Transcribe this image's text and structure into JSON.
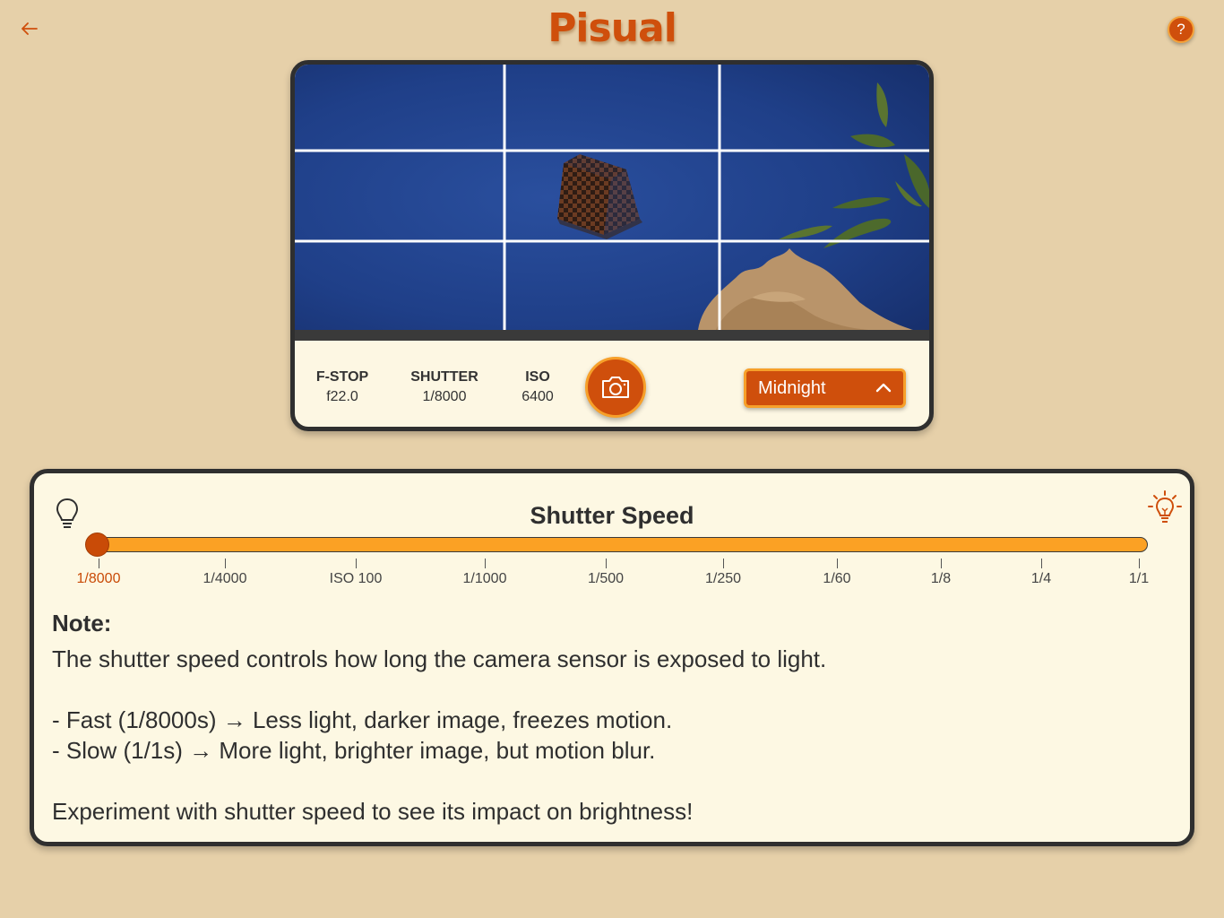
{
  "header": {
    "title": "Pisual",
    "back_icon": "back-arrow-icon",
    "help_label": "?"
  },
  "colors": {
    "background": "#e6d0a9",
    "accent": "#cf4f0c",
    "accent_light": "#fba124",
    "panel": "#fdf8e3",
    "border": "#2f2f2f"
  },
  "camera": {
    "settings": [
      {
        "label": "F-STOP",
        "value": "f22.0"
      },
      {
        "label": "SHUTTER",
        "value": "1/8000"
      },
      {
        "label": "ISO",
        "value": "6400"
      }
    ],
    "shutter_icon": "camera-icon",
    "preset": {
      "selected": "Midnight",
      "icon": "chevron-up-icon"
    },
    "viewport": {
      "grid": "rule-of-thirds",
      "subject": "checkered-cube",
      "background": "earth-satellite-view"
    }
  },
  "control": {
    "title": "Shutter Speed",
    "min_icon": "lightbulb-off-icon",
    "max_icon": "lightbulb-on-icon",
    "slider_value_fraction": 0,
    "ticks": [
      "1/8000",
      "1/4000",
      "ISO 100",
      "1/1000",
      "1/500",
      "1/250",
      "1/60",
      "1/8",
      "1/4",
      "1/1"
    ],
    "active_tick": "1/8000"
  },
  "note": {
    "title": "Note:",
    "lines": [
      "The shutter speed controls how long the camera sensor is exposed to light.",
      "",
      "- Fast (1/8000s) → Less light, darker image, freezes motion.",
      "- Slow (1/1s) → More light, brighter image, but motion blur.",
      "",
      "Experiment with shutter speed to see its impact on brightness!"
    ]
  }
}
